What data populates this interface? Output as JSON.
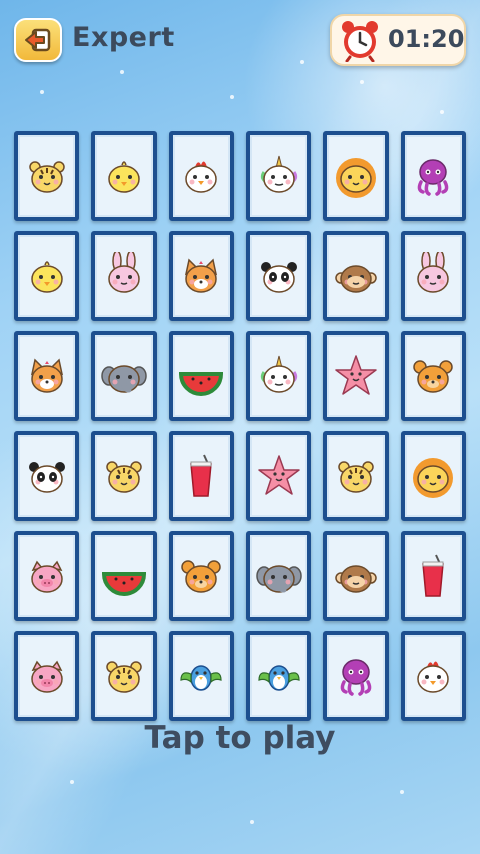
{
  "header": {
    "back_icon": "back-arrow-icon",
    "level": "Expert",
    "timer_icon": "alarm-clock-icon",
    "timer": "01:20"
  },
  "board": {
    "rows": 6,
    "columns": 6,
    "cards": [
      [
        "tiger",
        "chick",
        "chicken",
        "unicorn",
        "lion",
        "octopus"
      ],
      [
        "chick",
        "bunny",
        "fox",
        "panda",
        "monkey",
        "bunny"
      ],
      [
        "fox",
        "elephant",
        "watermelon",
        "unicorn",
        "starfish",
        "bear"
      ],
      [
        "panda",
        "tiger",
        "juice",
        "starfish",
        "tiger",
        "lion"
      ],
      [
        "pig",
        "watermelon",
        "bear",
        "elephant",
        "monkey",
        "juice"
      ],
      [
        "pig",
        "tiger",
        "bird",
        "bird",
        "octopus",
        "chicken"
      ]
    ]
  },
  "footer": {
    "prompt": "Tap to play"
  }
}
